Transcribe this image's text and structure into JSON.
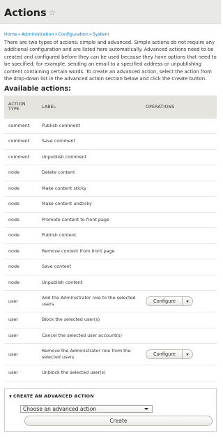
{
  "header": {
    "title": "Actions",
    "star_icon": "star-outline-icon"
  },
  "breadcrumb": [
    "Home",
    "Administration",
    "Configuration",
    "System"
  ],
  "breadcrumb_separator": "»",
  "intro": {
    "text_before": "There are two types of actions: simple and advanced. Simple actions do not require any additional configuration and are listed here automatically. Advanced actions need to be created and configured before they can be used because they have options that need to be specified; for example, sending an email to a specified address or unpublishing content containing certain words. To create an advanced action, select the action from the drop-down list in the advanced action section below and click the ",
    "emphasis": "Create",
    "text_after": " button."
  },
  "section_title": "Available actions:",
  "table": {
    "headers": {
      "type": "ACTION TYPE",
      "label": "LABEL",
      "operations": "OPERATIONS"
    },
    "rows": [
      {
        "type": "comment",
        "label": "Publish comment",
        "operation": ""
      },
      {
        "type": "comment",
        "label": "Save comment",
        "operation": ""
      },
      {
        "type": "comment",
        "label": "Unpublish comment",
        "operation": ""
      },
      {
        "type": "node",
        "label": "Delete content",
        "operation": ""
      },
      {
        "type": "node",
        "label": "Make content sticky",
        "operation": ""
      },
      {
        "type": "node",
        "label": "Make content unsticky",
        "operation": ""
      },
      {
        "type": "node",
        "label": "Promote content to front page",
        "operation": ""
      },
      {
        "type": "node",
        "label": "Publish content",
        "operation": ""
      },
      {
        "type": "node",
        "label": "Remove content from front page",
        "operation": ""
      },
      {
        "type": "node",
        "label": "Save content",
        "operation": ""
      },
      {
        "type": "node",
        "label": "Unpublish content",
        "operation": ""
      },
      {
        "type": "user",
        "label": "Add the Administrator role to the selected users",
        "operation": "Configure"
      },
      {
        "type": "user",
        "label": "Block the selected user(s)",
        "operation": ""
      },
      {
        "type": "user",
        "label": "Cancel the selected user account(s)",
        "operation": ""
      },
      {
        "type": "user",
        "label": "Remove the Administrator role from the selected users",
        "operation": "Configure"
      },
      {
        "type": "user",
        "label": "Unblock the selected user(s)",
        "operation": ""
      }
    ]
  },
  "advanced": {
    "summary": "CREATE AN ADVANCED ACTION",
    "select_value": "Choose an advanced action",
    "create_label": "Create"
  },
  "colors": {
    "link": "#0074bd",
    "header_bg": "#e9e9e6",
    "table_header_bg": "#e6e4df"
  }
}
